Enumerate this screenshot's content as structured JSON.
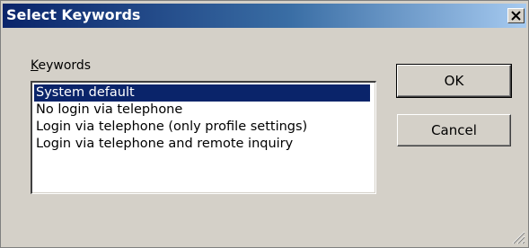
{
  "window": {
    "title": "Select Keywords",
    "close_icon": "close-icon"
  },
  "keywords": {
    "label_accesskey": "K",
    "label_rest": "eywords",
    "items": [
      {
        "label": "System default",
        "selected": true
      },
      {
        "label": "No login via telephone",
        "selected": false
      },
      {
        "label": "Login via telephone (only profile settings)",
        "selected": false
      },
      {
        "label": "Login via telephone and remote inquiry",
        "selected": false
      }
    ]
  },
  "buttons": {
    "ok": "OK",
    "cancel": "Cancel"
  },
  "colors": {
    "title_bar_start": "#0a246a",
    "title_bar_end": "#a6caf0",
    "selection": "#0a246a",
    "dialog_face": "#d4d0c8"
  }
}
